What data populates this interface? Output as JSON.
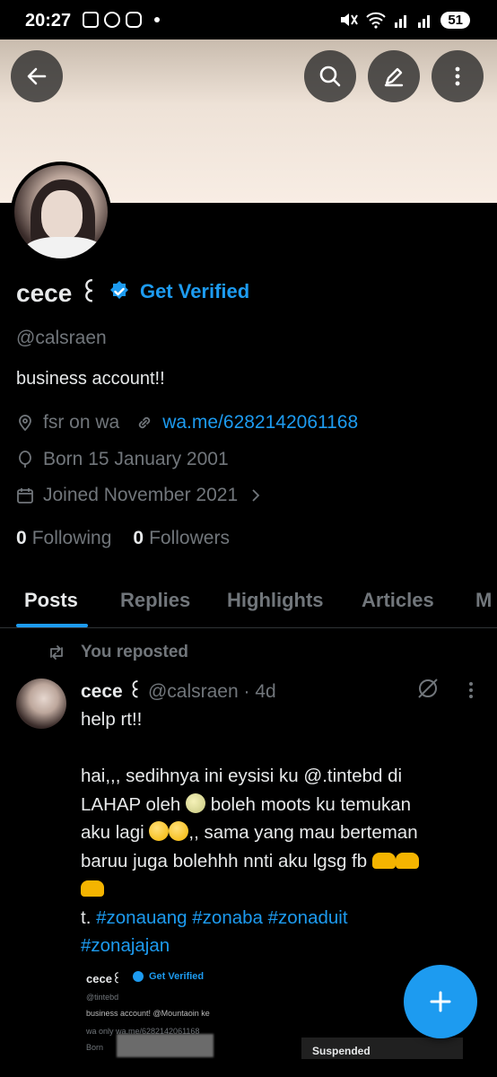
{
  "status_bar": {
    "time": "20:27",
    "battery": "51"
  },
  "header": {
    "back_icon": "arrow-left-icon",
    "search_icon": "search-icon",
    "edit_icon": "pencil-icon",
    "more_icon": "more-vertical-icon"
  },
  "profile": {
    "name": "cece ꒰",
    "get_verified": "Get Verified",
    "handle": "@calsraen",
    "bio": "business account!!",
    "location": "fsr on wa",
    "link": "wa.me/6282142061168",
    "born": "Born 15 January 2001",
    "joined": "Joined November 2021",
    "following_count": "0",
    "following_label": "Following",
    "followers_count": "0",
    "followers_label": "Followers"
  },
  "tabs": [
    "Posts",
    "Replies",
    "Highlights",
    "Articles",
    "M"
  ],
  "post": {
    "repost_label": "You reposted",
    "author_name": "cece ꒰",
    "author_handle_time": "@calsraen · 4d",
    "line1": "help rt!!",
    "line2": "hai,,, sedihnya ini eysisi ku @.tintebd di",
    "line3a": "LAHAP oleh",
    "line3b": "boleh moots ku temukan",
    "line4a": "aku lagi",
    "line4b": ",, sama yang mau berteman",
    "line5": "baruu juga bolehhh nnti aku lgsg fb",
    "line7a": "t.",
    "hashtags_line7": "#zonauang #zonaba #zonaduit",
    "hashtags_line8": "#zonajajan"
  },
  "embed": {
    "name": "cece꒰",
    "get_verified": "Get Verified",
    "handle": "@tintebd",
    "bio": "business account! @Mountaoin ke",
    "link": "wa only  wa.me/6282142061168",
    "born": "Born",
    "suspended": "Suspended"
  },
  "fab": {
    "icon": "plus-icon"
  },
  "colors": {
    "accent": "#1d9bf0",
    "muted": "#71767b",
    "text": "#e7e9ea",
    "background": "#000000"
  }
}
